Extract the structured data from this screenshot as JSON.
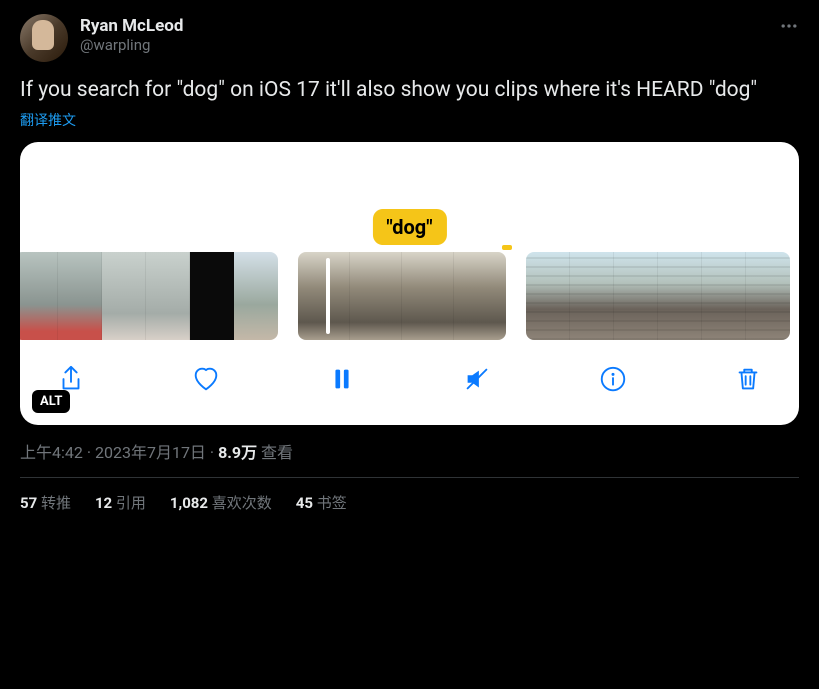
{
  "header": {
    "display_name": "Ryan McLeod",
    "handle": "@warpling"
  },
  "content": {
    "text": "If you search for \"dog\" on iOS 17 it'll also show you clips where it's HEARD \"dog\""
  },
  "translate_label": "翻译推文",
  "media": {
    "pill_text": "\"dog\"",
    "alt_label": "ALT"
  },
  "meta": {
    "time": "上午4:42",
    "dot1": " · ",
    "date": "2023年7月17日",
    "dot2": " · ",
    "views_num": "8.9万",
    "views_label": " 查看"
  },
  "stats": {
    "retweets_num": "57",
    "retweets_label": " 转推",
    "quotes_num": "12",
    "quotes_label": " 引用",
    "likes_num": "1,082",
    "likes_label": " 喜欢次数",
    "bookmarks_num": "45",
    "bookmarks_label": " 书签"
  }
}
